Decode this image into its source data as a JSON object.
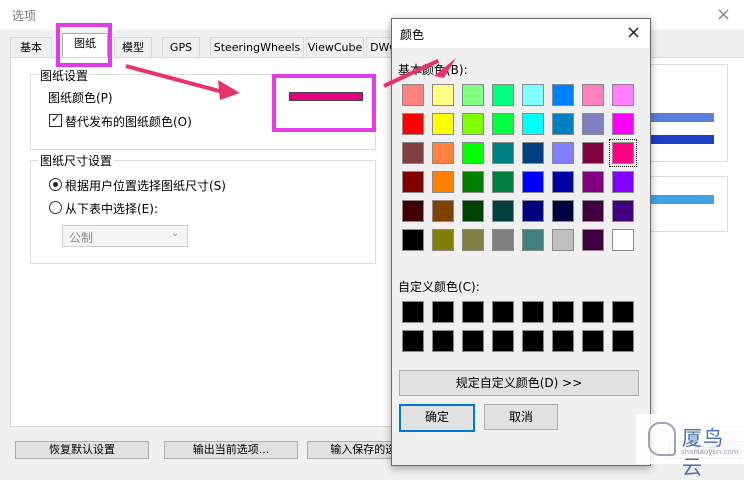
{
  "window": {
    "title": "选项",
    "close_glyph": "×"
  },
  "tabs": [
    {
      "label": "基本"
    },
    {
      "label": "图纸"
    },
    {
      "label": "模型"
    },
    {
      "label": "GPS"
    },
    {
      "label": "SteeringWheels"
    },
    {
      "label": "ViewCube"
    },
    {
      "label": "DWG"
    }
  ],
  "drawing_settings": {
    "group_title": "图纸设置",
    "color_label": "图纸颜色(P)",
    "current_color": "#E6007E",
    "alt_publish_label": "替代发布的图纸颜色(O)",
    "alt_publish_checked": true
  },
  "size_settings": {
    "group_title": "图纸尺寸设置",
    "option_user_location": "根据用户位置选择图纸尺寸(S)",
    "option_table": "从下表中选择(E):",
    "selected_option": "user_location",
    "unit_select_value": "公制"
  },
  "bottom_buttons": {
    "restore_defaults": "恢复默认设置",
    "export_current": "输出当前选项...",
    "import_saved": "输入保存的选项...",
    "ok": "确定",
    "cancel": "取消"
  },
  "color_dialog": {
    "title": "颜色",
    "close_glyph": "×",
    "basic_colors_label": "基本颜色(B):",
    "custom_colors_label": "自定义颜色(C):",
    "define_custom_button": "规定自定义颜色(D) >>",
    "ok": "确定",
    "cancel": "取消",
    "selected_color": "#FF0080",
    "basic_colors": [
      [
        "#FF8080",
        "#FFFF80",
        "#80FF80",
        "#00FF80",
        "#80FFFF",
        "#0080FF",
        "#FF80C0",
        "#FF80FF"
      ],
      [
        "#FF0000",
        "#FFFF00",
        "#80FF00",
        "#00FF40",
        "#00FFFF",
        "#0080C0",
        "#8080C0",
        "#FF00FF"
      ],
      [
        "#804040",
        "#FF8040",
        "#00FF00",
        "#008080",
        "#004080",
        "#8080FF",
        "#800040",
        "#FF0080"
      ],
      [
        "#800000",
        "#FF8000",
        "#008000",
        "#008040",
        "#0000FF",
        "#0000A0",
        "#800080",
        "#8000FF"
      ],
      [
        "#400000",
        "#804000",
        "#004000",
        "#004040",
        "#000080",
        "#000040",
        "#400040",
        "#400080"
      ],
      [
        "#000000",
        "#808000",
        "#808040",
        "#808080",
        "#408080",
        "#C0C0C0",
        "#400040",
        "#FFFFFF"
      ]
    ],
    "custom_colors": [
      [
        "#000000",
        "#000000",
        "#000000",
        "#000000",
        "#000000",
        "#000000",
        "#000000",
        "#000000"
      ],
      [
        "#000000",
        "#000000",
        "#000000",
        "#000000",
        "#000000",
        "#000000",
        "#000000",
        "#000000"
      ]
    ]
  },
  "accent": {
    "highlight_box": "#E23CE6",
    "arrow": "#E8336A"
  },
  "watermark": {
    "brand": "厦鸟云",
    "sub": "shaniaoyun.com"
  }
}
